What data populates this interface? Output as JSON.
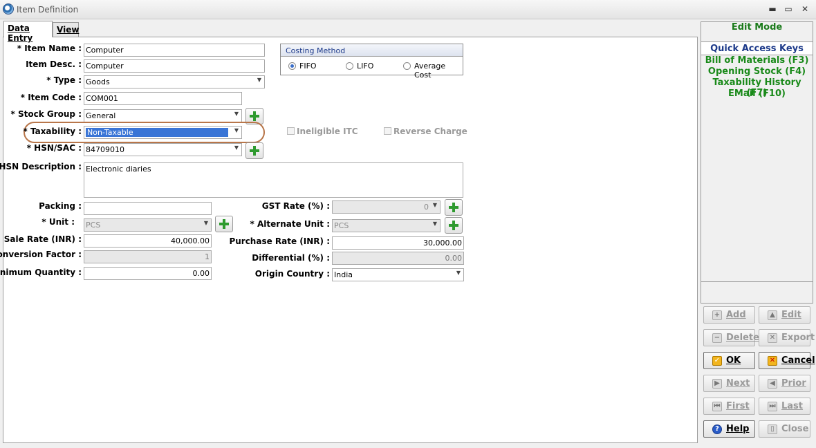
{
  "window": {
    "title": "Item Definition",
    "minimize": "▬",
    "maximize": "▭",
    "close": "✕"
  },
  "tabs": [
    {
      "label": "Data Entry"
    },
    {
      "label": "View"
    }
  ],
  "form": {
    "item_name": {
      "label": "* Item Name :",
      "value": "Computer"
    },
    "item_desc": {
      "label": "Item Desc. :",
      "value": "Computer"
    },
    "type": {
      "label": "* Type :",
      "value": "Goods"
    },
    "item_code": {
      "label": "* Item Code :",
      "value": "COM001"
    },
    "stock_group": {
      "label": "* Stock Group :",
      "value": "General"
    },
    "taxability": {
      "label": "* Taxability :",
      "value": "Non-Taxable"
    },
    "ineligible_itc": {
      "label": "Ineligible ITC"
    },
    "reverse_charge": {
      "label": "Reverse Charge"
    },
    "hsn_sac": {
      "label": "* HSN/SAC :",
      "value": "84709010"
    },
    "hsn_description": {
      "label": "* HSN Description :",
      "value": "Electronic diaries"
    },
    "packing": {
      "label": "Packing :",
      "value": ""
    },
    "unit": {
      "label": "* Unit :",
      "value": "PCS"
    },
    "sale_rate": {
      "label": "Sale Rate (INR) :",
      "value": "40,000.00"
    },
    "conversion_factor": {
      "label": "Conversion Factor :",
      "value": "1"
    },
    "minimum_quantity": {
      "label": "Minimum Quantity :",
      "value": "0.00"
    },
    "gst_rate": {
      "label": "GST Rate (%) :",
      "value": "0"
    },
    "alternate_unit": {
      "label": "* Alternate Unit :",
      "value": "PCS"
    },
    "purchase_rate": {
      "label": "Purchase Rate (INR) :",
      "value": "30,000.00"
    },
    "differential": {
      "label": "Differential (%) :",
      "value": "0.00"
    },
    "origin_country": {
      "label": "Origin Country :",
      "value": "India"
    }
  },
  "costing": {
    "title": "Costing Method",
    "options": [
      "FIFO",
      "LIFO",
      "Average Cost"
    ],
    "selected": "FIFO"
  },
  "side": {
    "mode": "Edit Mode",
    "quick_access_title": "Quick Access Keys",
    "quick_keys": [
      "Bill of Materials (F3)",
      "Opening Stock (F4)",
      "Taxability History (F7)",
      "EMail (F10)"
    ]
  },
  "actions": {
    "add": "Add",
    "edit": "Edit",
    "delete": "Delete",
    "export": "Export",
    "ok": "OK",
    "cancel": "Cancel",
    "next": "Next",
    "prior": "Prior",
    "first": "First",
    "last": "Last",
    "help": "Help",
    "close": "Close"
  },
  "colors": {
    "accent_green": "#1a8a1a",
    "header_blue": "#1d3a8a",
    "selection": "#3a75d6",
    "highlight_ring": "#b8764a"
  }
}
